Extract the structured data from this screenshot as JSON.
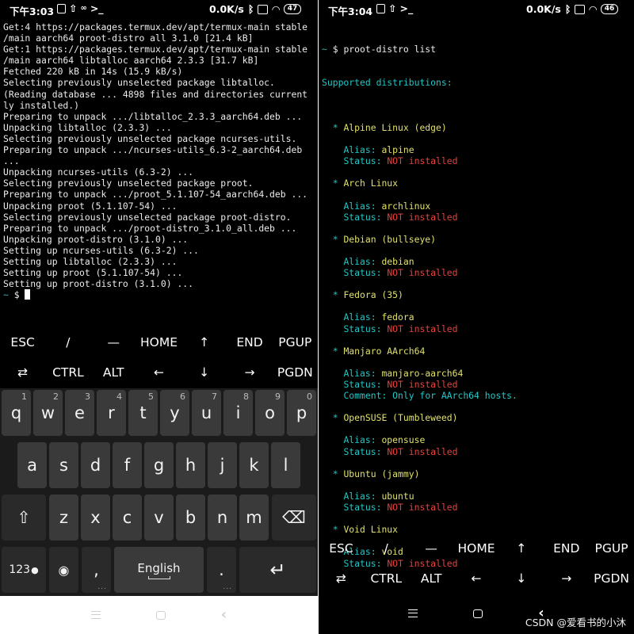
{
  "left": {
    "status": {
      "time": "下午3:03",
      "speed": "0.0K/s",
      "battery": "47",
      "icons_left": [
        "upload-box-icon",
        "upload-arrow-icon",
        "usb-debug-icon",
        "terminal-prompt-icon"
      ],
      "icons_right": [
        "bluetooth-icon",
        "sim-off-icon",
        "wifi-icon",
        "battery-icon"
      ]
    },
    "terminal_lines": [
      "Get:4 https://packages.termux.dev/apt/termux-main stable",
      "/main aarch64 proot-distro all 3.1.0 [21.4 kB]",
      "Get:1 https://packages.termux.dev/apt/termux-main stable",
      "/main aarch64 libtalloc aarch64 2.3.3 [31.7 kB]",
      "Fetched 220 kB in 14s (15.9 kB/s)",
      "Selecting previously unselected package libtalloc.",
      "(Reading database ... 4898 files and directories current",
      "ly installed.)",
      "Preparing to unpack .../libtalloc_2.3.3_aarch64.deb ...",
      "Unpacking libtalloc (2.3.3) ...",
      "Selecting previously unselected package ncurses-utils.",
      "Preparing to unpack .../ncurses-utils_6.3-2_aarch64.deb",
      "...",
      "Unpacking ncurses-utils (6.3-2) ...",
      "Selecting previously unselected package proot.",
      "Preparing to unpack .../proot_5.1.107-54_aarch64.deb ...",
      "Unpacking proot (5.1.107-54) ...",
      "Selecting previously unselected package proot-distro.",
      "Preparing to unpack .../proot-distro_3.1.0_all.deb ...",
      "Unpacking proot-distro (3.1.0) ...",
      "Setting up ncurses-utils (6.3-2) ...",
      "Setting up libtalloc (2.3.3) ...",
      "Setting up proot (5.1.107-54) ...",
      "Setting up proot-distro (3.1.0) ..."
    ],
    "prompt": {
      "tilde": "~",
      "dollar": " $ "
    },
    "extra_keys_row1": [
      "ESC",
      "/",
      "—",
      "HOME",
      "↑",
      "END",
      "PGUP"
    ],
    "extra_keys_row2": [
      "⇄",
      "CTRL",
      "ALT",
      "←",
      "↓",
      "→",
      "PGDN"
    ],
    "keyboard": {
      "row1": [
        {
          "key": "q",
          "num": "1"
        },
        {
          "key": "w",
          "num": "2"
        },
        {
          "key": "e",
          "num": "3"
        },
        {
          "key": "r",
          "num": "4"
        },
        {
          "key": "t",
          "num": "5"
        },
        {
          "key": "y",
          "num": "6"
        },
        {
          "key": "u",
          "num": "7"
        },
        {
          "key": "i",
          "num": "8"
        },
        {
          "key": "o",
          "num": "9"
        },
        {
          "key": "p",
          "num": "0"
        }
      ],
      "row2": [
        "a",
        "s",
        "d",
        "f",
        "g",
        "h",
        "j",
        "k",
        "l"
      ],
      "row3": [
        "z",
        "x",
        "c",
        "v",
        "b",
        "n",
        "m"
      ],
      "shift_glyph": "⇧",
      "backspace_glyph": "⌫",
      "numbers_key": "123",
      "mic_glyph": "🎙",
      "emoji_glyph": "◉",
      "comma": ",",
      "space_label": "English",
      "period": ".",
      "enter_glyph": "↵"
    },
    "navbar": {
      "menu": "menu-icon",
      "home": "home-icon",
      "back": "‹"
    }
  },
  "right": {
    "status": {
      "time": "下午3:04",
      "speed": "0.0K/s",
      "battery": "46",
      "icons_left": [
        "upload-box-icon",
        "upload-arrow-icon",
        "terminal-prompt-icon"
      ],
      "icons_right": [
        "bluetooth-icon",
        "sim-off-icon",
        "wifi-icon",
        "battery-icon"
      ]
    },
    "command": {
      "tilde": "~",
      "dollar": " $ ",
      "text": "proot-distro list"
    },
    "header": "Supported distributions:",
    "distros": [
      {
        "name": "Alpine Linux (edge)",
        "alias": "alpine",
        "status": "NOT installed"
      },
      {
        "name": "Arch Linux",
        "alias": "archlinux",
        "status": "NOT installed"
      },
      {
        "name": "Debian (bullseye)",
        "alias": "debian",
        "status": "NOT installed"
      },
      {
        "name": "Fedora (35)",
        "alias": "fedora",
        "status": "NOT installed"
      },
      {
        "name": "Manjaro AArch64",
        "alias": "manjaro-aarch64",
        "status": "NOT installed",
        "comment": "Only for AArch64 hosts."
      },
      {
        "name": "OpenSUSE (Tumbleweed)",
        "alias": "opensuse",
        "status": "NOT installed"
      },
      {
        "name": "Ubuntu (jammy)",
        "alias": "ubuntu",
        "status": "NOT installed"
      },
      {
        "name": "Void Linux",
        "alias": "void",
        "status": "NOT installed"
      }
    ],
    "labels": {
      "bullet": "* ",
      "alias": "Alias: ",
      "status": "Status: ",
      "comment": "Comment: "
    },
    "extra_keys_row1": [
      "ESC",
      "/",
      "—",
      "HOME",
      "↑",
      "END",
      "PGUP"
    ],
    "extra_keys_row2": [
      "⇄",
      "CTRL",
      "ALT",
      "←",
      "↓",
      "→",
      "PGDN"
    ],
    "navbar": {
      "menu": "menu-icon",
      "home": "home-icon",
      "back": "‹"
    }
  },
  "watermark": "CSDN @爱看书的小沐",
  "colors": {
    "terminal_bg": "#000000",
    "terminal_text": "#ececec",
    "cyan": "#21c7c7",
    "yellow": "#e0e06a",
    "red": "#e8403a",
    "keyboard_bg": "#1b1b1b",
    "key_bg": "#3a3a3a"
  }
}
